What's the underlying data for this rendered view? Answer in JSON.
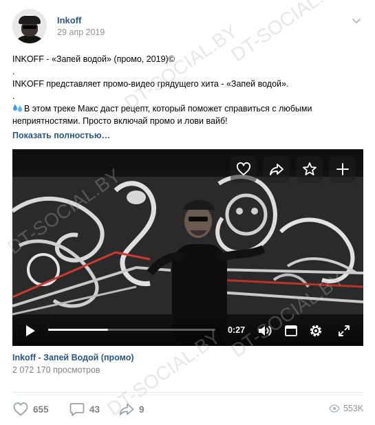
{
  "post": {
    "author": "Inkoff",
    "date": "29 апр 2019",
    "text_lines": [
      "INKOFF - «Запей водой» (промо, 2019)©",
      ".",
      "INKOFF представляет промо-видео грядущего хита - «Запей водой».",
      ".",
      "В этом треке Макс даст рецепт, который поможет справиться с любыми",
      "неприятностями. Просто включай промо и лови вайб!"
    ],
    "show_more": "Показать полностью…"
  },
  "video": {
    "current_time": "0:27",
    "progress": 0.36,
    "title": "Inkoff - Запей Водой (промо)",
    "views": "2 072 170 просмотров",
    "overlay_actions": [
      "heart-icon",
      "share-icon",
      "star-icon",
      "plus-icon"
    ],
    "controls": [
      "play-icon",
      "volume-icon",
      "miniplayer-icon",
      "settings-icon",
      "fullscreen-icon"
    ]
  },
  "actions": {
    "likes": "655",
    "comments": "43",
    "shares": "9",
    "views": "553K"
  },
  "watermark": "DT-SOCIAL.BY",
  "colors": {
    "link": "#2a5885",
    "meta": "#939393",
    "divider": "#e7e8ec",
    "icon": "#99a2ad"
  }
}
